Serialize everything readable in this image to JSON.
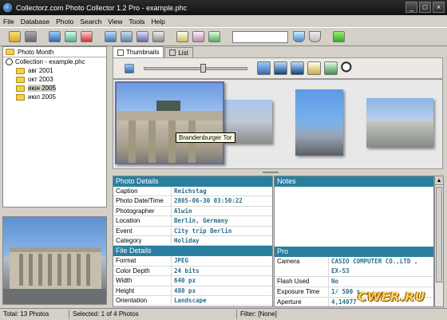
{
  "window": {
    "title": "Collectorz.com Photo Collector 1.2 Pro - example.phc"
  },
  "menu": [
    "File",
    "Database",
    "Photo",
    "Search",
    "View",
    "Tools",
    "Help"
  ],
  "toolbar": {
    "search_value": ""
  },
  "left_panel": {
    "header": "Photo Month",
    "root": "Collection - example.phc",
    "items": [
      "авг 2001",
      "окт 2003",
      "июн 2005",
      "июл 2005"
    ],
    "selected_index": 2
  },
  "tabs": [
    {
      "label": "Thumbnails"
    },
    {
      "label": "List"
    }
  ],
  "thumbnails": {
    "tooltip": "Brandenburger Tor"
  },
  "photo_details": {
    "heading": "Photo Details",
    "rows": [
      {
        "key": "Caption",
        "value": "Reichstag"
      },
      {
        "key": "Photo Date/Time",
        "value": "2005-06-30 03:50:22"
      },
      {
        "key": "Photographer",
        "value": "Alwin"
      },
      {
        "key": "Location",
        "value": "Berlin, Germany"
      },
      {
        "key": "Event",
        "value": "City trip Berlin"
      },
      {
        "key": "Category",
        "value": "Holiday"
      }
    ]
  },
  "file_details": {
    "heading": "File Details",
    "rows": [
      {
        "key": "Format",
        "value": "JPEG"
      },
      {
        "key": "Color Depth",
        "value": "24 bits"
      },
      {
        "key": "Width",
        "value": "640 px"
      },
      {
        "key": "Height",
        "value": "480 px"
      },
      {
        "key": "Orientation",
        "value": "Landscape"
      }
    ]
  },
  "notes": {
    "heading": "Notes"
  },
  "pro": {
    "heading": "Pro",
    "rows": [
      {
        "key": "Camera",
        "value": "CASIO COMPUTER CO.,LTD ,",
        "value2": "EX-S3"
      },
      {
        "key": "Flash Used",
        "value": "No"
      },
      {
        "key": "Exposure Time",
        "value": "1/ 500 s"
      },
      {
        "key": "Aperture",
        "value": "4,14077"
      }
    ]
  },
  "status": {
    "total": "Total: 13 Photos",
    "selected": "Selected: 1 of 4 Photos",
    "filter": "Filter: [None]"
  },
  "watermark": "CWER.RU",
  "colors": {
    "section_header": "#2a7f9e",
    "value_text": "#2a6e8a",
    "titlebar": "#111111"
  }
}
